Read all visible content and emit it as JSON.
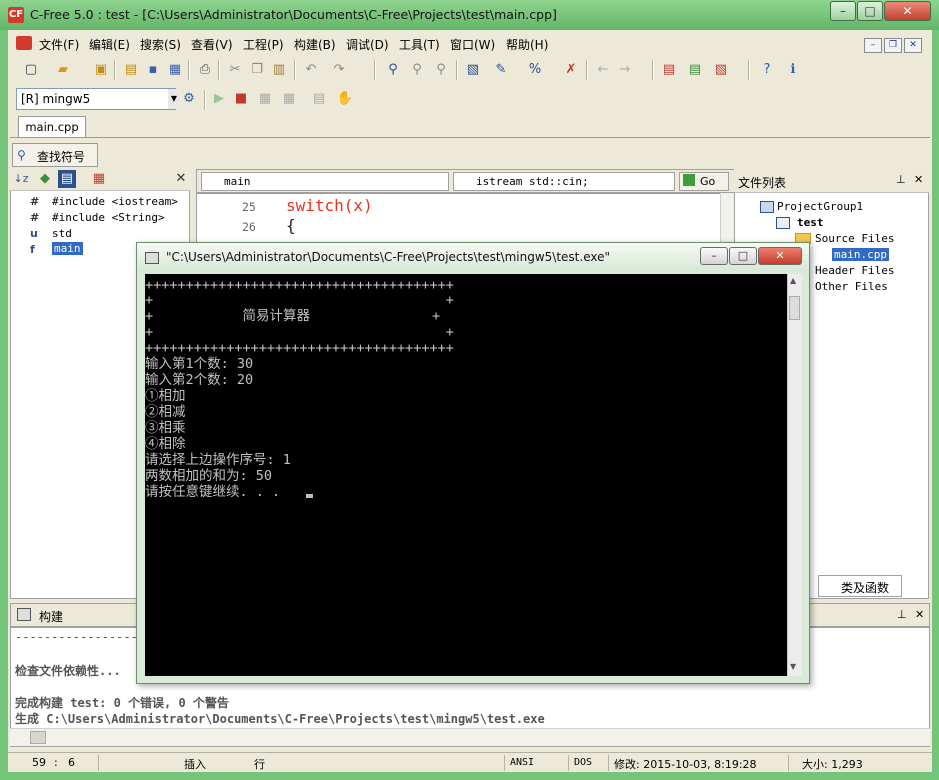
{
  "app": {
    "title": "C-Free 5.0 : test - [C:\\Users\\Administrator\\Documents\\C-Free\\Projects\\test\\main.cpp]",
    "icon_text": "CF",
    "caption_buttons": {
      "minimize": "–",
      "maximize": "□",
      "close": "✕"
    }
  },
  "menu": {
    "items": [
      "文件(F)",
      "编辑(E)",
      "搜索(S)",
      "查看(V)",
      "工程(P)",
      "构建(B)",
      "调试(D)",
      "工具(T)",
      "窗口(W)",
      "帮助(H)"
    ],
    "mdi_buttons": {
      "minimize": "–",
      "restore": "❐",
      "close": "✕"
    }
  },
  "toolbar": {
    "compiler": "[R] mingw5"
  },
  "tabs": {
    "document": "main.cpp"
  },
  "find_symbol": {
    "label": "查找符号"
  },
  "symbols": {
    "items": [
      {
        "glyph": "#",
        "label": "#include <iostream>"
      },
      {
        "glyph": "#",
        "label": "#include <String>"
      },
      {
        "glyph": "u",
        "label": "std"
      },
      {
        "glyph": "f",
        "label": "main"
      }
    ]
  },
  "editor": {
    "function_combo": "main",
    "scope_combo": "istream std::cin;",
    "go_label": "Go",
    "lines": [
      {
        "number": "25",
        "code": "switch(x)"
      },
      {
        "number": "26",
        "code": "{"
      }
    ]
  },
  "files": {
    "title": "文件列表",
    "tree": [
      {
        "label": "ProjectGroup1",
        "level": 0
      },
      {
        "label": "test",
        "level": 1
      },
      {
        "label": "Source Files",
        "level": 2
      },
      {
        "label": "main.cpp",
        "level": 3
      },
      {
        "label": "Header Files",
        "level": 2
      },
      {
        "label": "Other Files",
        "level": 2
      }
    ],
    "bottom_tab": "类及函数"
  },
  "build": {
    "title": "构建",
    "lines": [
      "----------------------",
      "",
      "检查文件依赖性...",
      "",
      "完成构建 test: 0 个错误, 0 个警告",
      "生成 C:\\Users\\Administrator\\Documents\\C-Free\\Projects\\test\\mingw5\\test.exe"
    ]
  },
  "status": {
    "line": "59",
    "col": "6",
    "insert": "插入",
    "row_label": "行",
    "encoding": "ANSI",
    "eol": "DOS",
    "modified": "修改: 2015-10-03, 8:19:28",
    "size": "大小: 1,293"
  },
  "console": {
    "title": "\"C:\\Users\\Administrator\\Documents\\C-Free\\Projects\\test\\mingw5\\test.exe\"",
    "caption_buttons": {
      "minimize": "–",
      "maximize": "□",
      "close": "✕"
    },
    "output": [
      "++++++++++++++++++++++++++++++++++++++",
      "+                                    +",
      "+           简易计算器               +",
      "+                                    +",
      "++++++++++++++++++++++++++++++++++++++",
      "输入第1个数: 30",
      "输入第2个数: 20",
      "①相加",
      "②相减",
      "③相乘",
      "④相除",
      "请选择上边操作序号: 1",
      "两数相加的和为: 50",
      "请按任意键继续. . ."
    ]
  }
}
